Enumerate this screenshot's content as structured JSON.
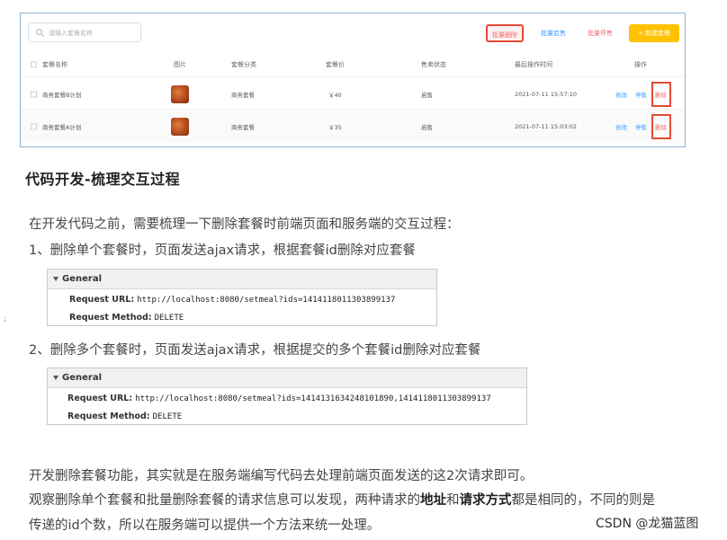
{
  "ui": {
    "search_placeholder": "请输入套餐名称",
    "toolbar": {
      "batch_delete": "批量删除",
      "batch_start": "批量启售",
      "batch_stop": "批量停售",
      "new": "+ 新建套餐"
    },
    "columns": [
      "套餐名称",
      "图片",
      "套餐分类",
      "套餐价",
      "售卖状态",
      "最后操作时间",
      "操作"
    ],
    "rows": [
      {
        "name": "商务套餐B计划",
        "category": "商务套餐",
        "price": "￥40",
        "status": "启售",
        "time": "2021-07-11 15:57:10",
        "edit": "修改",
        "stop": "停售",
        "delete": "删除"
      },
      {
        "name": "商务套餐A计划",
        "category": "商务套餐",
        "price": "￥35",
        "status": "启售",
        "time": "2021-07-11 15:03:02",
        "edit": "修改",
        "stop": "停售",
        "delete": "删除"
      }
    ]
  },
  "article": {
    "heading": "代码开发-梳理交互过程",
    "intro": "在开发代码之前，需要梳理一下删除套餐时前端页面和服务端的交互过程：",
    "step1": "1、删除单个套餐时，页面发送ajax请求，根据套餐id删除对应套餐",
    "general1": {
      "title": "General",
      "url_label": "Request URL:",
      "url_value": "http://localhost:8080/setmeal?ids=1414118011303899137",
      "method_label": "Request Method:",
      "method_value": "DELETE"
    },
    "step2": "2、删除多个套餐时，页面发送ajax请求，根据提交的多个套餐id删除对应套餐",
    "general2": {
      "title": "General",
      "url_label": "Request URL:",
      "url_value": "http://localhost:8080/setmeal?ids=1414131634248101890,1414118011303899137",
      "method_label": "Request Method:",
      "method_value": "DELETE"
    },
    "para1": "开发删除套餐功能，其实就是在服务端编写代码去处理前端页面发送的这2次请求即可。",
    "para2_a": "观察删除单个套餐和批量删除套餐的请求信息可以发现，两种请求的",
    "para2_b": "地址",
    "para2_c": "和",
    "para2_d": "请求方式",
    "para2_e": "都是相同的，不同的则是",
    "para3": "传递的id个数，所以在服务端可以提供一个方法来统一处理。",
    "bullet": ";",
    "watermark": "CSDN @龙猫蓝图"
  }
}
